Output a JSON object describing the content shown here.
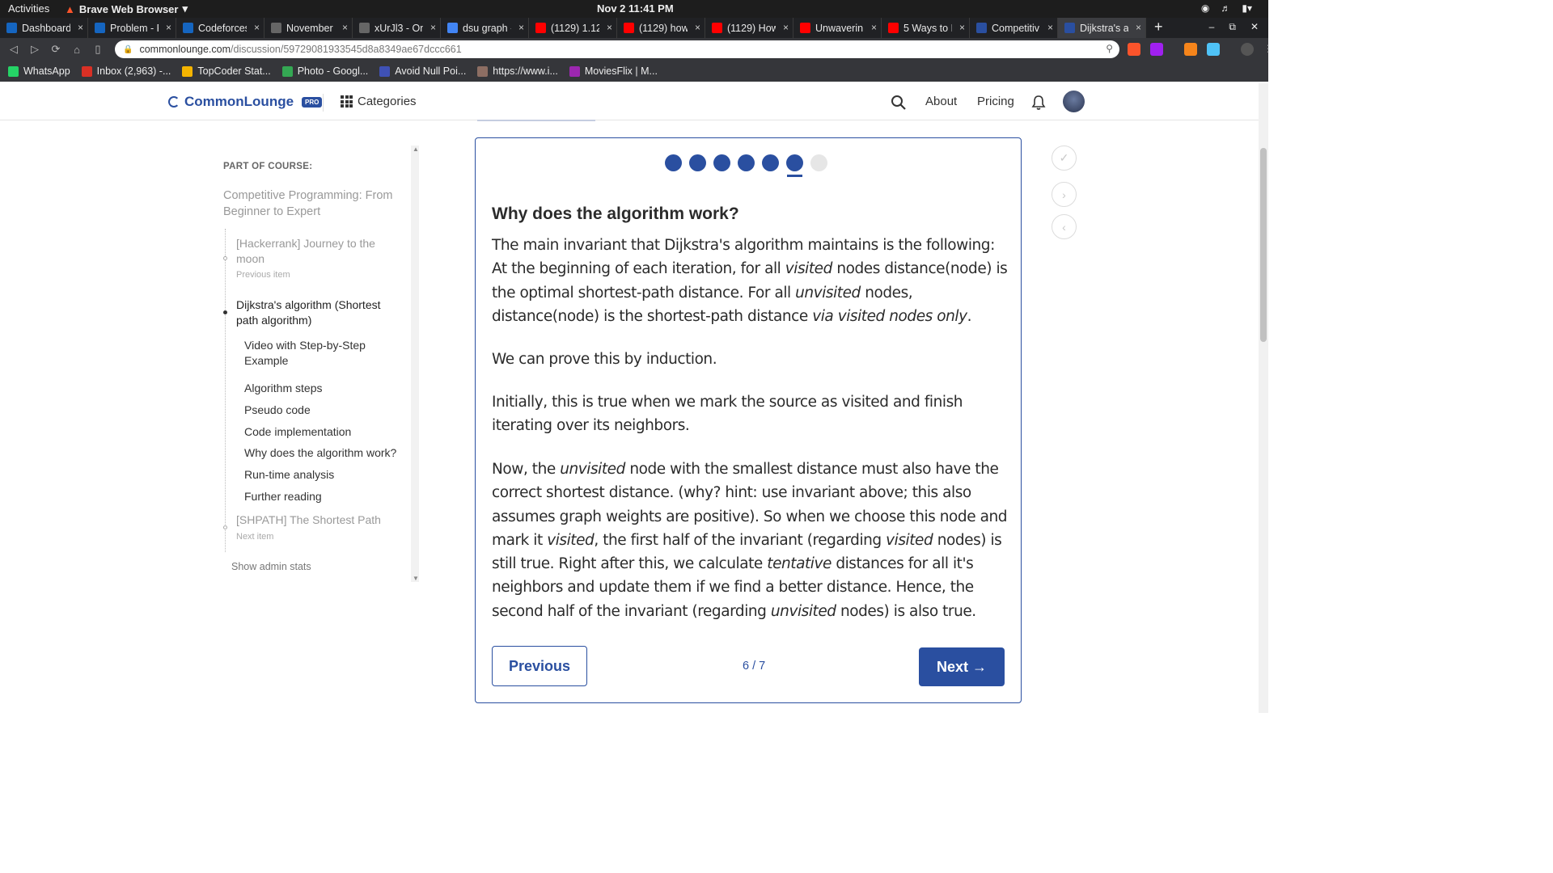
{
  "system": {
    "activities": "Activities",
    "app_name": "Brave Web Browser",
    "clock": "Nov 2  11:41 PM"
  },
  "tabs": [
    {
      "label": "Dashboard",
      "color": "#1565c0"
    },
    {
      "label": "Problem - F",
      "color": "#1565c0"
    },
    {
      "label": "Codeforces",
      "color": "#1565c0"
    },
    {
      "label": "November",
      "color": "#666666"
    },
    {
      "label": "xUrJl3 - On",
      "color": "#666666"
    },
    {
      "label": "dsu graph -",
      "color": "#4285f4"
    },
    {
      "label": "(1129) 1.12",
      "color": "#ff0000"
    },
    {
      "label": "(1129) how",
      "color": "#ff0000"
    },
    {
      "label": "(1129) How",
      "color": "#ff0000"
    },
    {
      "label": "Unwaverin",
      "color": "#ff0000"
    },
    {
      "label": "5 Ways to E",
      "color": "#ff0000"
    },
    {
      "label": "Competitiv",
      "color": "#2a4fa0"
    },
    {
      "label": "Dijkstra's a",
      "color": "#2a4fa0",
      "active": true
    }
  ],
  "address": {
    "domain": "commonlounge.com",
    "path": "/discussion/59729081933545d8a8349ae67dccc661"
  },
  "bookmarks": [
    {
      "label": "WhatsApp",
      "color": "#25d366"
    },
    {
      "label": "Inbox (2,963) -...",
      "color": "#d93025"
    },
    {
      "label": "TopCoder Stat...",
      "color": "#f4b400"
    },
    {
      "label": "Photo - Googl...",
      "color": "#34a853"
    },
    {
      "label": "Avoid Null Poi...",
      "color": "#3f51b5"
    },
    {
      "label": "https://www.i...",
      "color": "#8d6e63"
    },
    {
      "label": "MoviesFlix | M...",
      "color": "#9c27b0"
    }
  ],
  "header": {
    "brand": "CommonLounge",
    "badge": "PRO",
    "categories": "Categories",
    "about": "About",
    "pricing": "Pricing",
    "accent": "#2a4fa0"
  },
  "sidebar": {
    "part_label": "PART OF COURSE:",
    "course": "Competitive Programming: From Beginner to Expert",
    "previous": {
      "title": "[Hackerrank] Journey to the moon",
      "meta": "Previous item"
    },
    "current": "Dijkstra's algorithm (Shortest path algorithm)",
    "sections": [
      "Video with Step-by-Step Example",
      "Algorithm steps",
      "Pseudo code",
      "Code implementation",
      "Why does the algorithm work?",
      "Run-time analysis",
      "Further reading"
    ],
    "next": {
      "title": "[SHPATH] The Shortest Path",
      "meta": "Next item"
    },
    "admin": "Show admin stats"
  },
  "card": {
    "progress": {
      "completed": 6,
      "total": 7
    },
    "heading": "Why does the algorithm work?",
    "counter": "6 / 7",
    "prev_label": "Previous",
    "next_label": "Next →"
  }
}
